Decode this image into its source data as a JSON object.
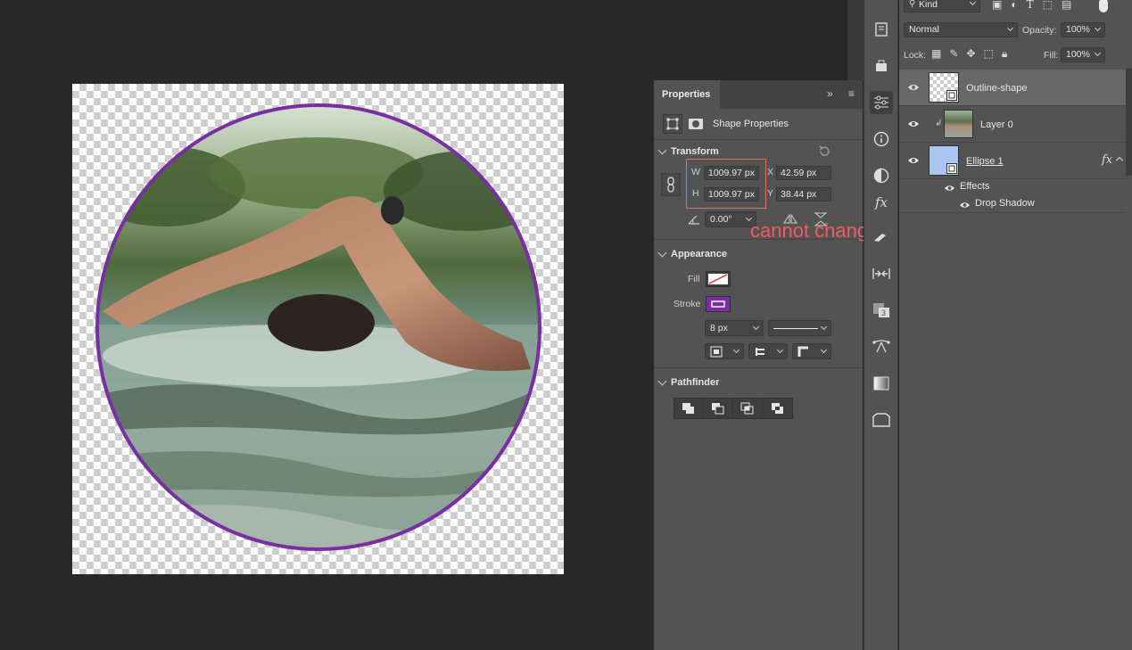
{
  "properties": {
    "tab_label": "Properties",
    "header_title": "Shape Properties",
    "transform": {
      "title": "Transform",
      "w_label": "W",
      "w_value": "1009.97 px",
      "h_label": "H",
      "h_value": "1009.97 px",
      "x_label": "X",
      "x_value": "42.59 px",
      "y_label": "Y",
      "y_value": "38.44 px",
      "angle_value": "0.00°"
    },
    "appearance": {
      "title": "Appearance",
      "fill_label": "Fill",
      "stroke_label": "Stroke",
      "stroke_width": "8 px",
      "stroke_color": "#7a2fa0"
    },
    "pathfinder": {
      "title": "Pathfinder"
    }
  },
  "annotation": {
    "text": "cannot change size",
    "color": "#ee5c62"
  },
  "layers": {
    "filter_kind": "Kind",
    "blend_mode": "Normal",
    "opacity_label": "Opacity:",
    "opacity_value": "100%",
    "lock_label": "Lock:",
    "fill_label": "Fill:",
    "fill_value": "100%",
    "items": [
      {
        "name": "Outline-shape"
      },
      {
        "name": "Layer 0"
      },
      {
        "name": "Ellipse 1",
        "fx": "fx"
      }
    ],
    "effects_label": "Effects",
    "drop_shadow_label": "Drop Shadow"
  },
  "colors": {
    "ellipse_stroke": "#7a2fa0",
    "panel_bg": "#535353",
    "app_bg": "#282828"
  }
}
